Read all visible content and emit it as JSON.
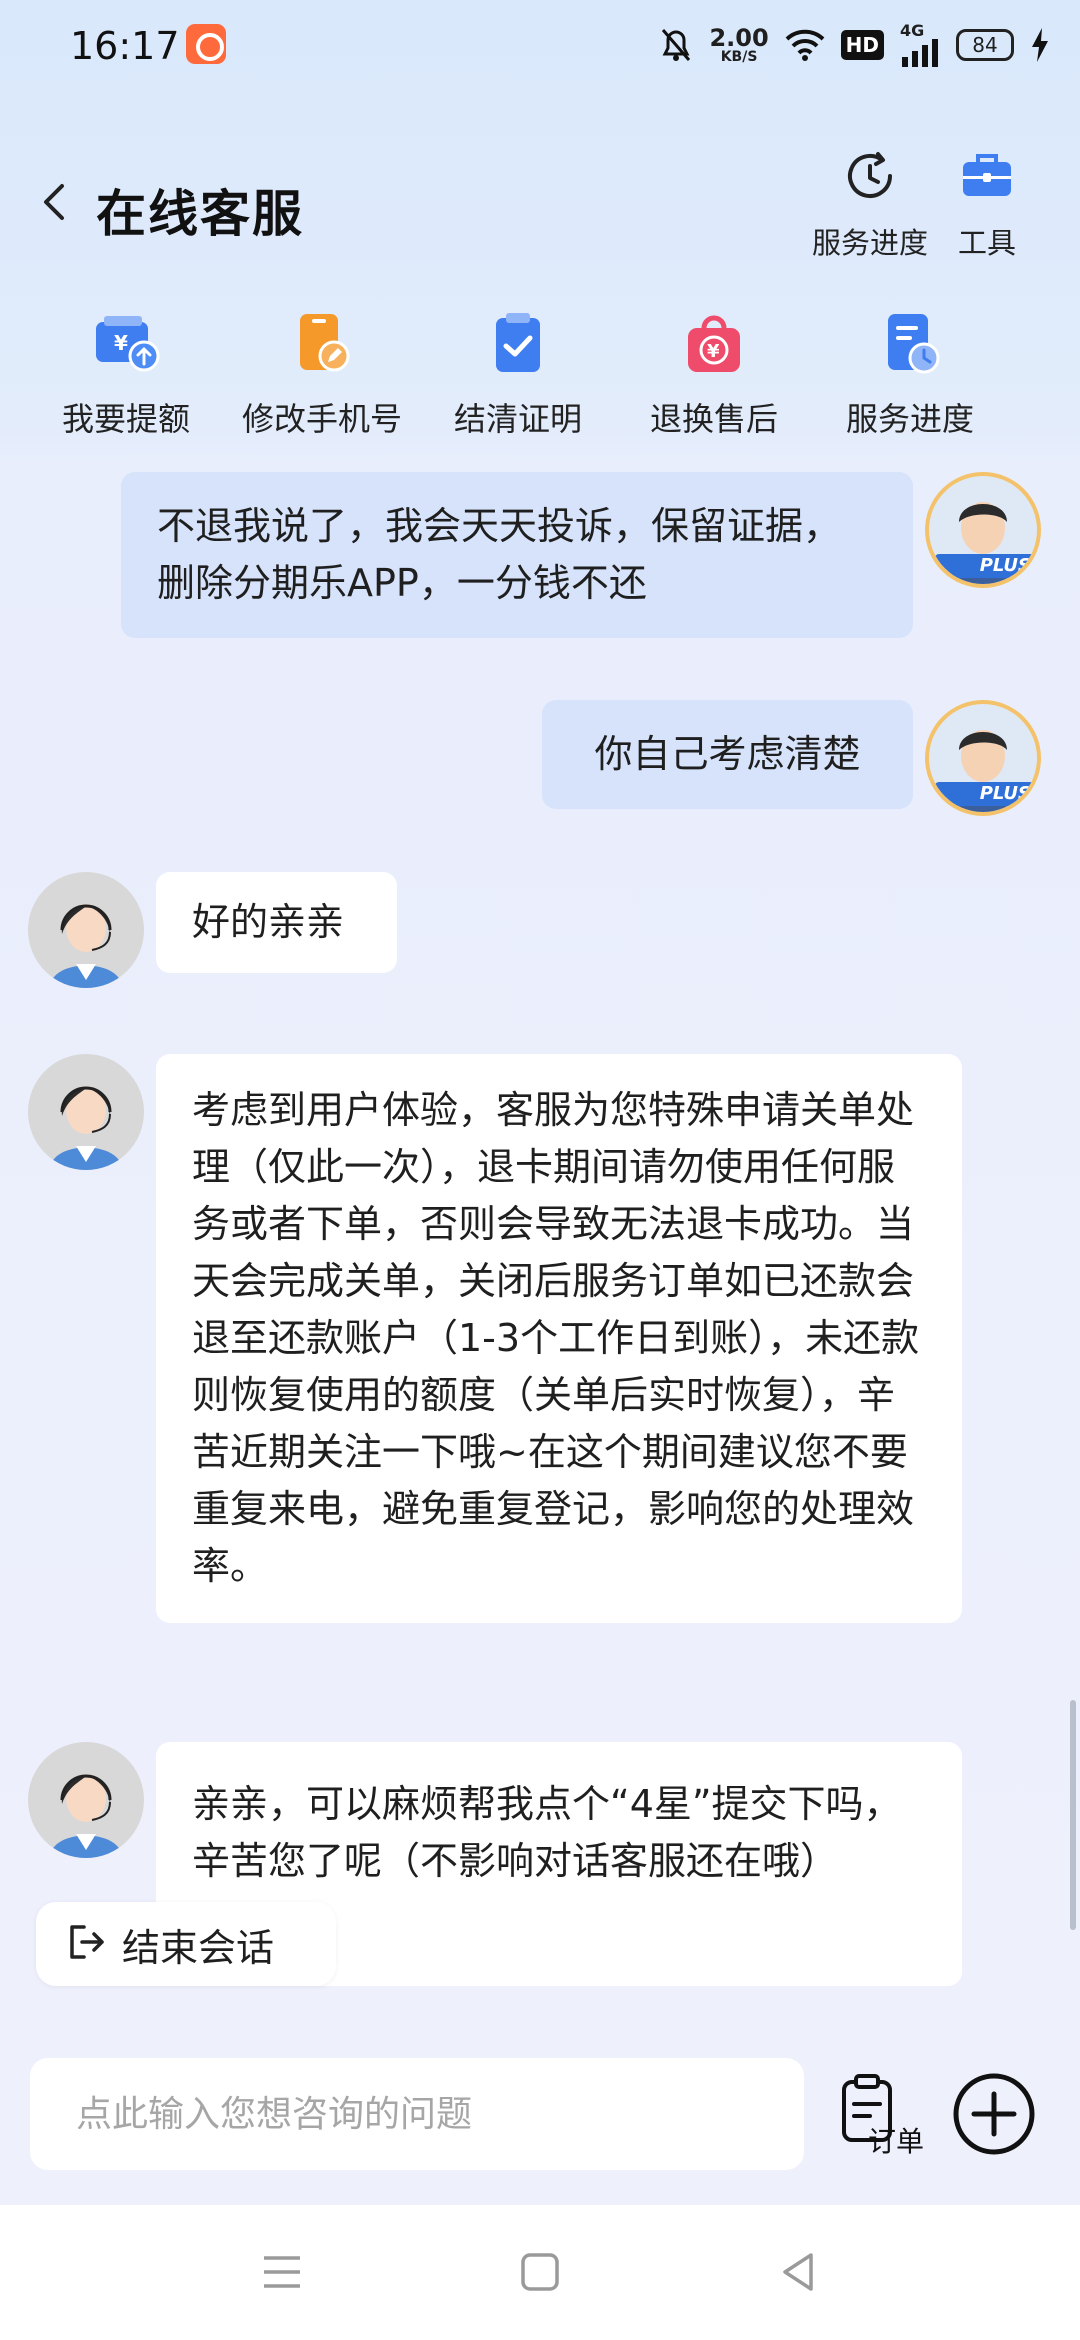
{
  "status_bar": {
    "time": "16:17",
    "net_speed_value": "2.00",
    "net_speed_unit": "KB/S",
    "hd": "HD",
    "signal": "4G",
    "battery": "84"
  },
  "header": {
    "title": "在线客服",
    "actions": [
      {
        "label": "服务进度",
        "icon": "clock-refresh-icon"
      },
      {
        "label": "工具",
        "icon": "toolbox-icon"
      }
    ]
  },
  "quick_actions": [
    {
      "label": "我要提额",
      "icon": "wallet-up-icon",
      "color": "#3f7ef0"
    },
    {
      "label": "修改手机号",
      "icon": "phone-edit-icon",
      "color": "#f59a2a"
    },
    {
      "label": "结清证明",
      "icon": "clipboard-check-icon",
      "color": "#3f7ef0"
    },
    {
      "label": "退换售后",
      "icon": "bag-refund-icon",
      "color": "#ef4b6a"
    },
    {
      "label": "服务进度",
      "icon": "doc-clock-icon",
      "color": "#3f7ef0"
    }
  ],
  "messages": [
    {
      "from": "user",
      "text": "不退我说了，我会天天投诉，保留证据，删除分期乐APP，一分钱不还"
    },
    {
      "from": "user",
      "text": "你自己考虑清楚"
    },
    {
      "from": "agent",
      "text": "好的亲亲"
    },
    {
      "from": "agent",
      "text": "考虑到用户体验，客服为您特殊申请关单处理（仅此一次），退卡期间请勿使用任何服务或者下单，否则会导致无法退卡成功。当天会完成关单，关闭后服务订单如已还款会退至还款账户（1-3个工作日到账），未还款则恢复使用的额度（关单后实时恢复），辛苦近期关注一下哦~在这个期间建议您不要重复来电，避免重复登记，影响您的处理效率。"
    },
    {
      "from": "agent",
      "text": "亲亲，可以麻烦帮我点个“4星”提交下吗，辛苦您了呢（不影响对话客服还在哦）"
    }
  ],
  "user_badge": "PLUS",
  "end_session": {
    "label": "结束会话"
  },
  "input": {
    "placeholder": "点此输入您想咨询的问题"
  },
  "order_button": {
    "label": "订单"
  },
  "colors": {
    "accent": "#3f7ef0",
    "user_bubble": "#d6e3fa",
    "agent_bubble": "#ffffff"
  }
}
